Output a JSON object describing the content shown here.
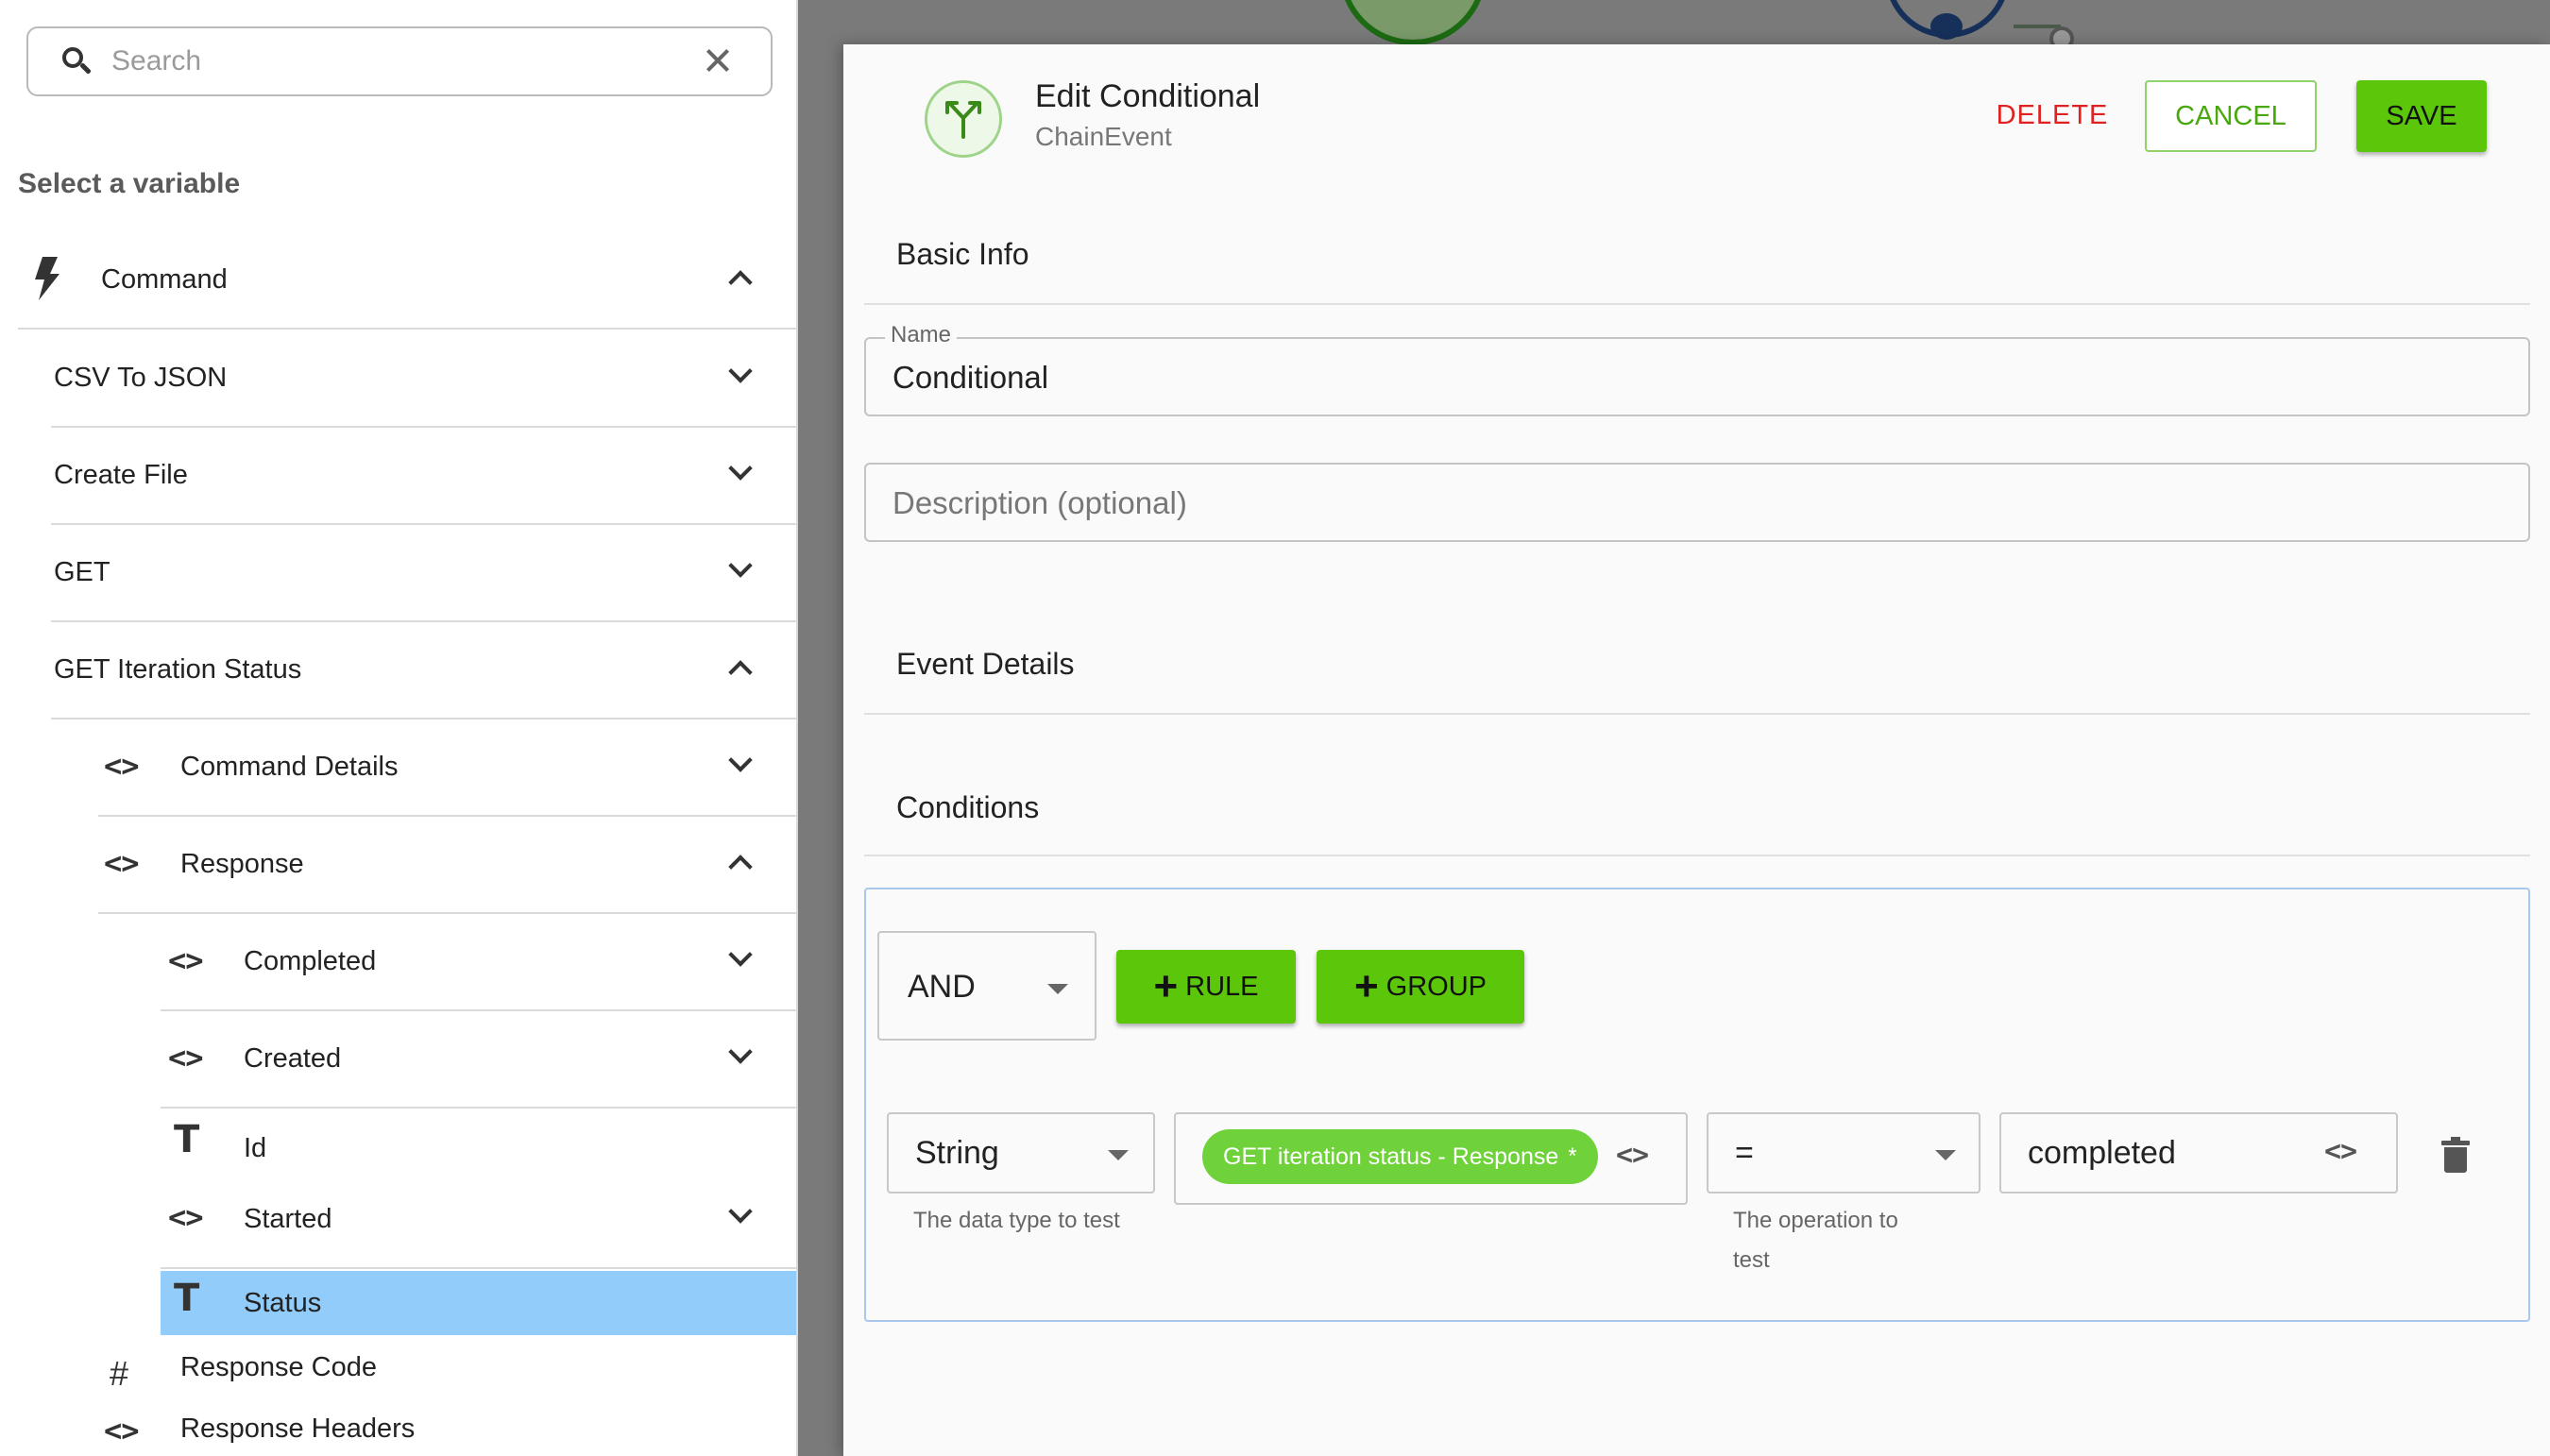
{
  "search": {
    "placeholder": "Search"
  },
  "picker": {
    "title": "Select a variable",
    "items": [
      {
        "label": "Command",
        "icon": "lightning-icon",
        "expanded": true
      },
      {
        "label": "CSV To JSON"
      },
      {
        "label": "Create File"
      },
      {
        "label": "GET"
      },
      {
        "label": "GET Iteration Status",
        "expanded": true
      },
      {
        "label": "Command Details",
        "icon": "code-icon"
      },
      {
        "label": "Response",
        "icon": "code-icon",
        "expanded": true
      },
      {
        "label": "Completed",
        "icon": "code-icon"
      },
      {
        "label": "Created",
        "icon": "code-icon"
      },
      {
        "label": "Id",
        "icon": "text-type-icon"
      },
      {
        "label": "Started",
        "icon": "code-icon"
      },
      {
        "label": "Status",
        "icon": "text-type-icon",
        "selected": true
      },
      {
        "label": "Response Code",
        "icon": "number-type-icon"
      },
      {
        "label": "Response Headers",
        "icon": "code-icon"
      }
    ]
  },
  "modal": {
    "title": "Edit Conditional",
    "subtitle": "ChainEvent",
    "delete_label": "DELETE",
    "cancel_label": "CANCEL",
    "save_label": "SAVE",
    "sections": {
      "basic_info": "Basic Info",
      "event_details": "Event Details",
      "conditions": "Conditions"
    },
    "name_field": {
      "label": "Name",
      "value": "Conditional"
    },
    "description_field": {
      "placeholder": "Description (optional)"
    },
    "conditions": {
      "operator": "AND",
      "add_rule_label": "RULE",
      "add_group_label": "GROUP",
      "rule": {
        "data_type": "String",
        "data_type_helper": "The data type to test",
        "variable_chip": "GET iteration status - Response",
        "variable_chip_mark": "*",
        "operation": "=",
        "operation_helper": "The operation to test",
        "value": "completed"
      }
    }
  },
  "colors": {
    "accent_green": "#5cc60a",
    "delete_red": "#e02121",
    "selected_row": "#92ccfa"
  }
}
